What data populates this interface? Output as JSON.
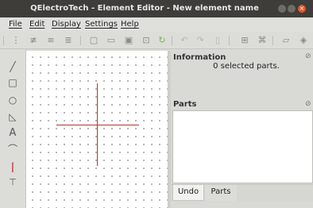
{
  "window": {
    "title": "QElectroTech - Element Editor - New element name"
  },
  "menu": {
    "items": [
      "File",
      "Edit",
      "Display",
      "Settings",
      "Help"
    ]
  },
  "toolbar": {
    "icons": [
      "select-all-icon",
      "deselect-all-icon",
      "invert-selection-icon",
      "select-icon",
      "new-icon",
      "open-icon",
      "save-icon",
      "save-as-icon",
      "reload-icon",
      "undo-icon",
      "redo-icon",
      "delete-icon",
      "zoom-fit-icon",
      "zoom-reset-icon",
      "edit-names-icon",
      "edit-properties-icon"
    ]
  },
  "tools": {
    "icons": [
      "line-icon",
      "rectangle-icon",
      "ellipse-icon",
      "polygon-icon",
      "text-icon",
      "arc-icon",
      "terminal-icon",
      "text-field-icon"
    ]
  },
  "info_panel": {
    "title": "Information",
    "text": "0 selected parts."
  },
  "parts_panel": {
    "title": "Parts"
  },
  "tabs": {
    "undo": "Undo",
    "parts": "Parts"
  },
  "colors": {
    "accent": "#c0302b",
    "close": "#e1572b",
    "titlebar": "#3e3d39"
  }
}
